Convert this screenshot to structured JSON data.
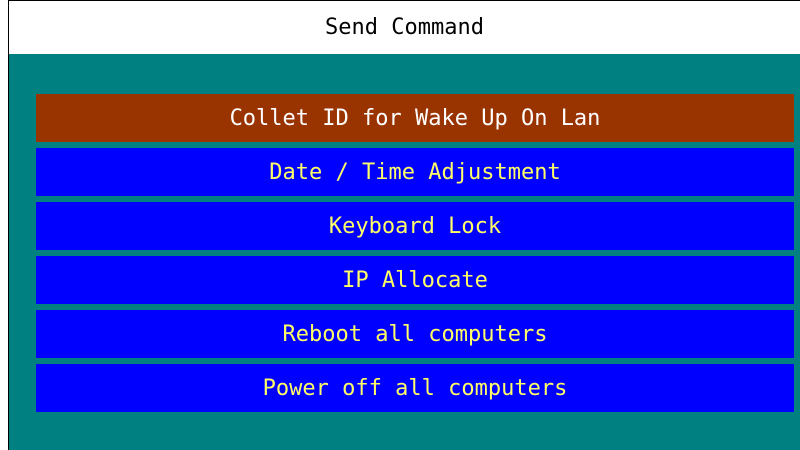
{
  "window": {
    "title": "Send Command"
  },
  "colors": {
    "panel_background": "#008080",
    "selected_item_background": "#993300",
    "item_background": "#0000ff",
    "selected_item_text": "#ffffff",
    "item_text": "#ffff66"
  },
  "menu": {
    "selected_index": 0,
    "items": [
      {
        "label": "Collet ID for Wake Up On Lan"
      },
      {
        "label": "Date / Time Adjustment"
      },
      {
        "label": "Keyboard Lock"
      },
      {
        "label": "IP Allocate"
      },
      {
        "label": "Reboot all computers"
      },
      {
        "label": "Power off all computers"
      }
    ]
  }
}
